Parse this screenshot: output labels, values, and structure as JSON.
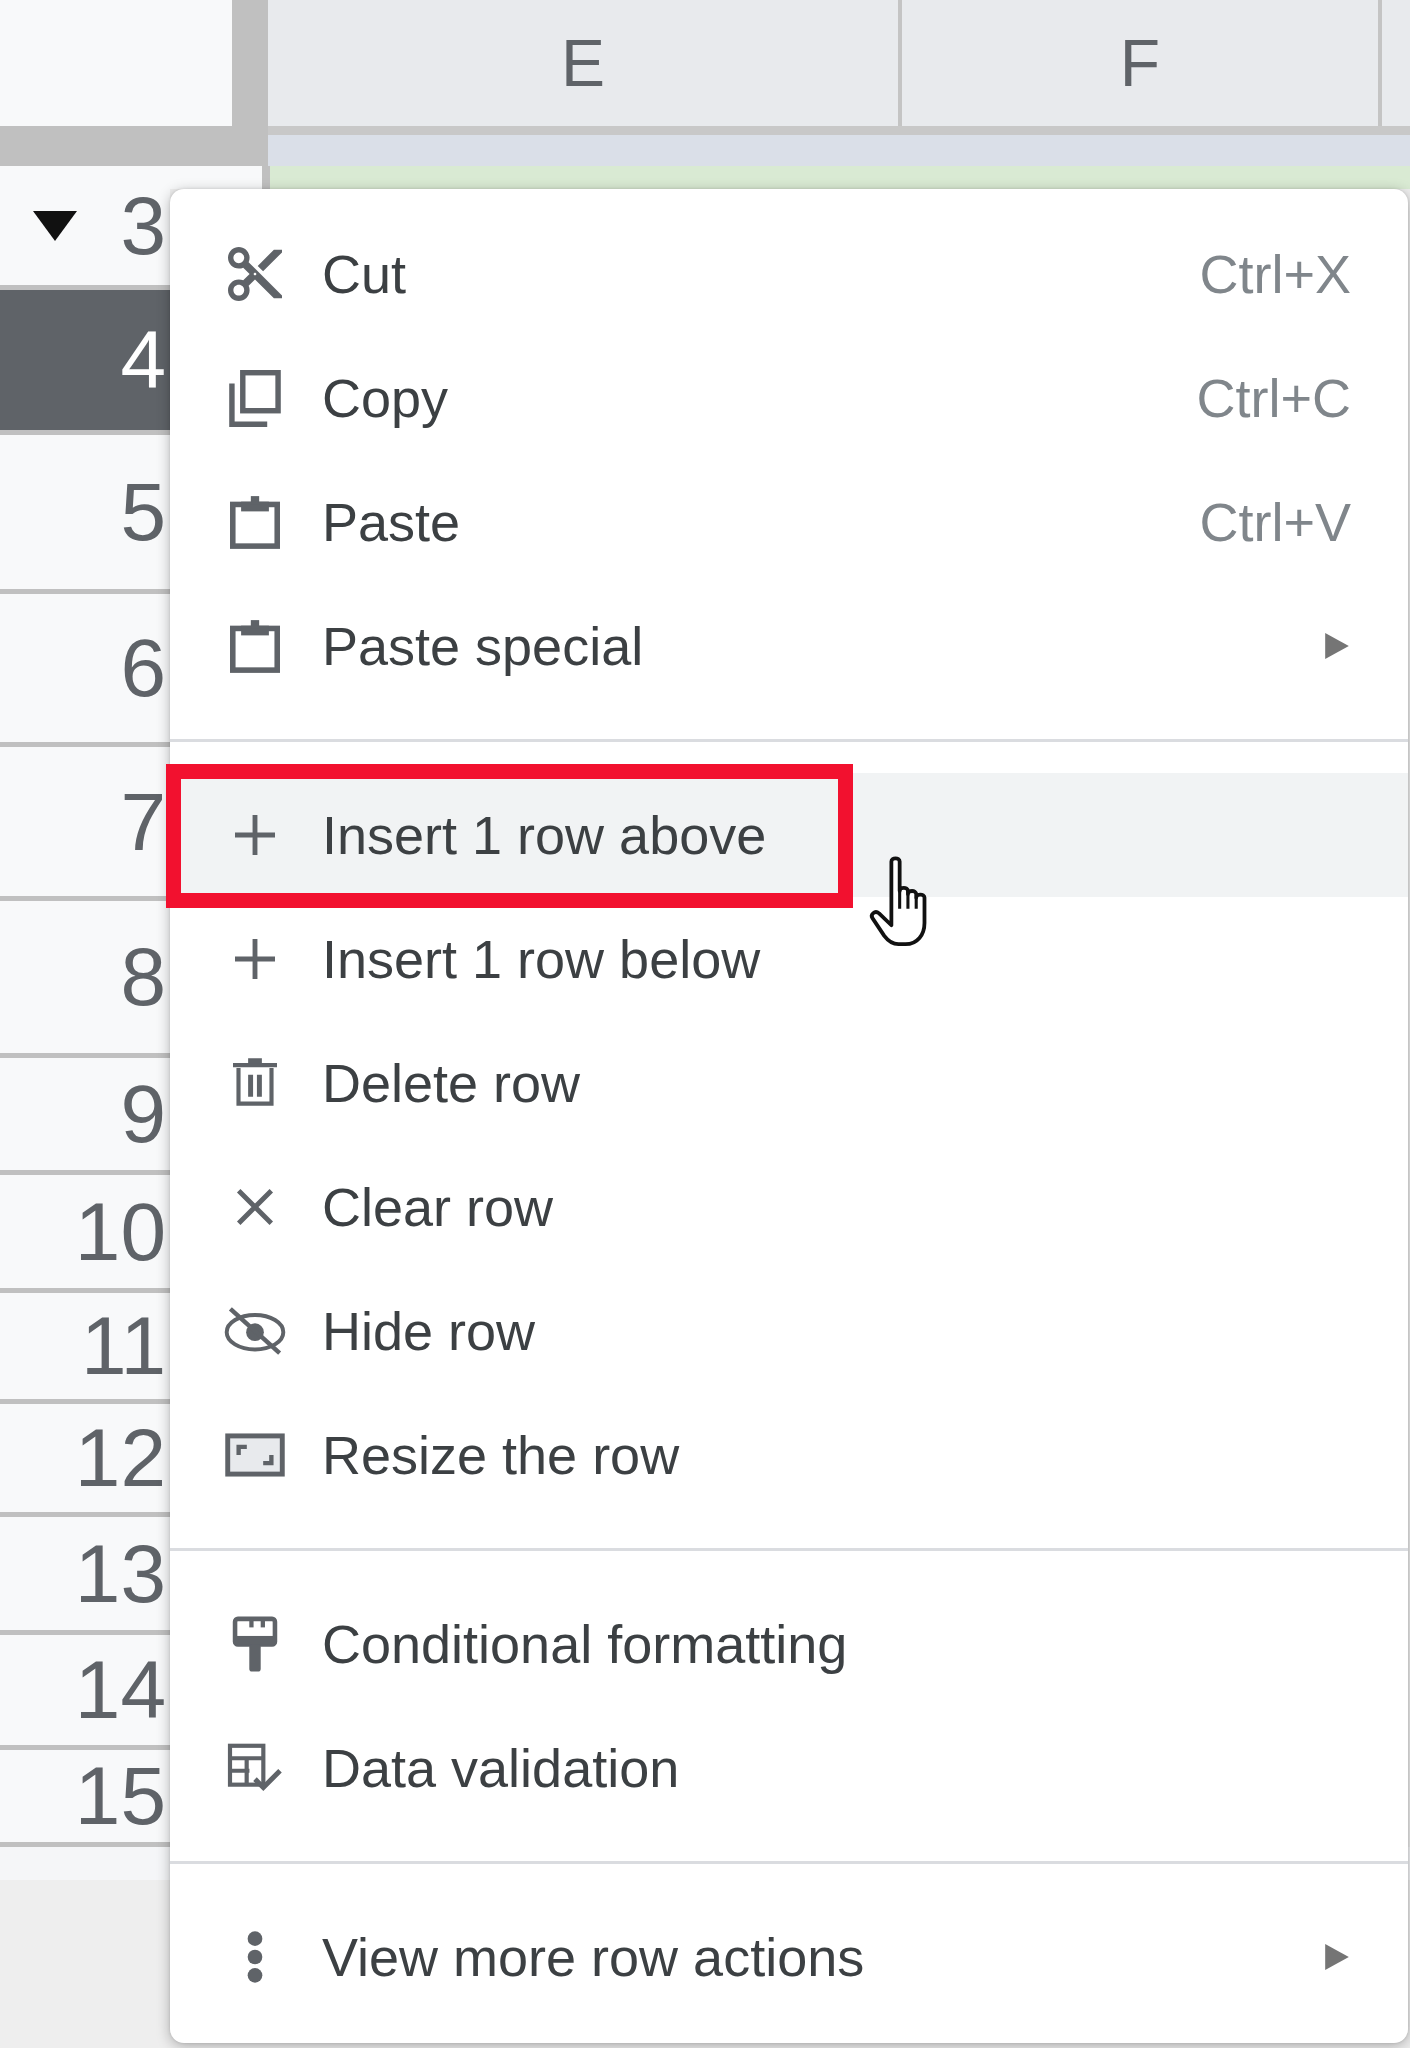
{
  "sheet": {
    "columns": [
      {
        "label": "E"
      },
      {
        "label": "F"
      }
    ],
    "rows": [
      {
        "number": "3",
        "selected": false,
        "kind": "group",
        "expanded": true,
        "color": "#d9ead3"
      },
      {
        "number": "4",
        "selected": true,
        "kind": "plain"
      },
      {
        "number": "5",
        "selected": false,
        "kind": "plain"
      },
      {
        "number": "6",
        "selected": false,
        "kind": "plain"
      },
      {
        "number": "7",
        "selected": false,
        "kind": "plain"
      },
      {
        "number": "8",
        "selected": false,
        "kind": "plain"
      },
      {
        "number": "9",
        "selected": false,
        "kind": "plain"
      },
      {
        "number": "10",
        "selected": false,
        "kind": "plain"
      },
      {
        "number": "11",
        "selected": false,
        "kind": "plain"
      },
      {
        "number": "12",
        "selected": false,
        "kind": "plain"
      },
      {
        "number": "13",
        "selected": false,
        "kind": "plain"
      },
      {
        "number": "14",
        "selected": false,
        "kind": "plain"
      },
      {
        "number": "15",
        "selected": false,
        "kind": "plain"
      }
    ]
  },
  "menu": {
    "groups": [
      {
        "items": [
          {
            "label": "Cut",
            "shortcut": "Ctrl+X",
            "submenu": false,
            "hovered": false,
            "annotated": false
          },
          {
            "label": "Copy",
            "shortcut": "Ctrl+C",
            "submenu": false,
            "hovered": false,
            "annotated": false
          },
          {
            "label": "Paste",
            "shortcut": "Ctrl+V",
            "submenu": false,
            "hovered": false,
            "annotated": false
          },
          {
            "label": "Paste special",
            "submenu": true,
            "hovered": false,
            "annotated": false
          }
        ]
      },
      {
        "items": [
          {
            "label": "Insert 1 row above",
            "submenu": false,
            "hovered": true,
            "annotated": true
          },
          {
            "label": "Insert 1 row below",
            "submenu": false,
            "hovered": false,
            "annotated": false
          },
          {
            "label": "Delete row",
            "submenu": false,
            "hovered": false,
            "annotated": false
          },
          {
            "label": "Clear row",
            "submenu": false,
            "hovered": false,
            "annotated": false
          },
          {
            "label": "Hide row",
            "submenu": false,
            "hovered": false,
            "annotated": false
          },
          {
            "label": "Resize the row",
            "submenu": false,
            "hovered": false,
            "annotated": false
          }
        ]
      },
      {
        "items": [
          {
            "label": "Conditional formatting",
            "submenu": false,
            "hovered": false,
            "annotated": false
          },
          {
            "label": "Data validation",
            "submenu": false,
            "hovered": false,
            "annotated": false
          }
        ]
      },
      {
        "items": [
          {
            "label": "View more row actions",
            "submenu": true,
            "hovered": false,
            "annotated": false
          }
        ]
      }
    ]
  }
}
